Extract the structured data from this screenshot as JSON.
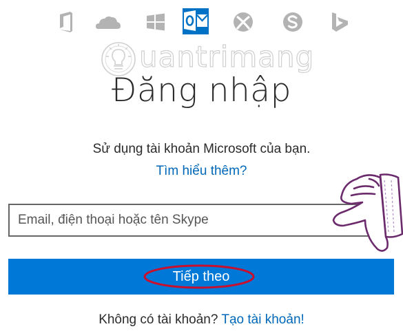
{
  "app_icons": [
    {
      "name": "office-icon",
      "active": false
    },
    {
      "name": "onedrive-icon",
      "active": false
    },
    {
      "name": "windows-icon",
      "active": false
    },
    {
      "name": "outlook-icon",
      "active": true
    },
    {
      "name": "xbox-icon",
      "active": false
    },
    {
      "name": "skype-icon",
      "active": false
    },
    {
      "name": "bing-icon",
      "active": false
    }
  ],
  "watermark": {
    "text": "uantrimang"
  },
  "login": {
    "title": "Đăng nhập",
    "subtitle": "Sử dụng tài khoản Microsoft của bạn.",
    "learn_more": "Tìm hiểu thêm?",
    "email_placeholder": "Email, điện thoại hoặc tên Skype",
    "email_value": "",
    "next_label": "Tiếp theo",
    "no_account_text": "Không có tài khoản?",
    "create_account": "Tạo tài khoản!"
  },
  "colors": {
    "accent": "#0078d7",
    "link": "#0067b8",
    "icon_gray": "#b3b3b3",
    "annotation": "#c8102e",
    "hand_outline": "#6b2a6b"
  }
}
